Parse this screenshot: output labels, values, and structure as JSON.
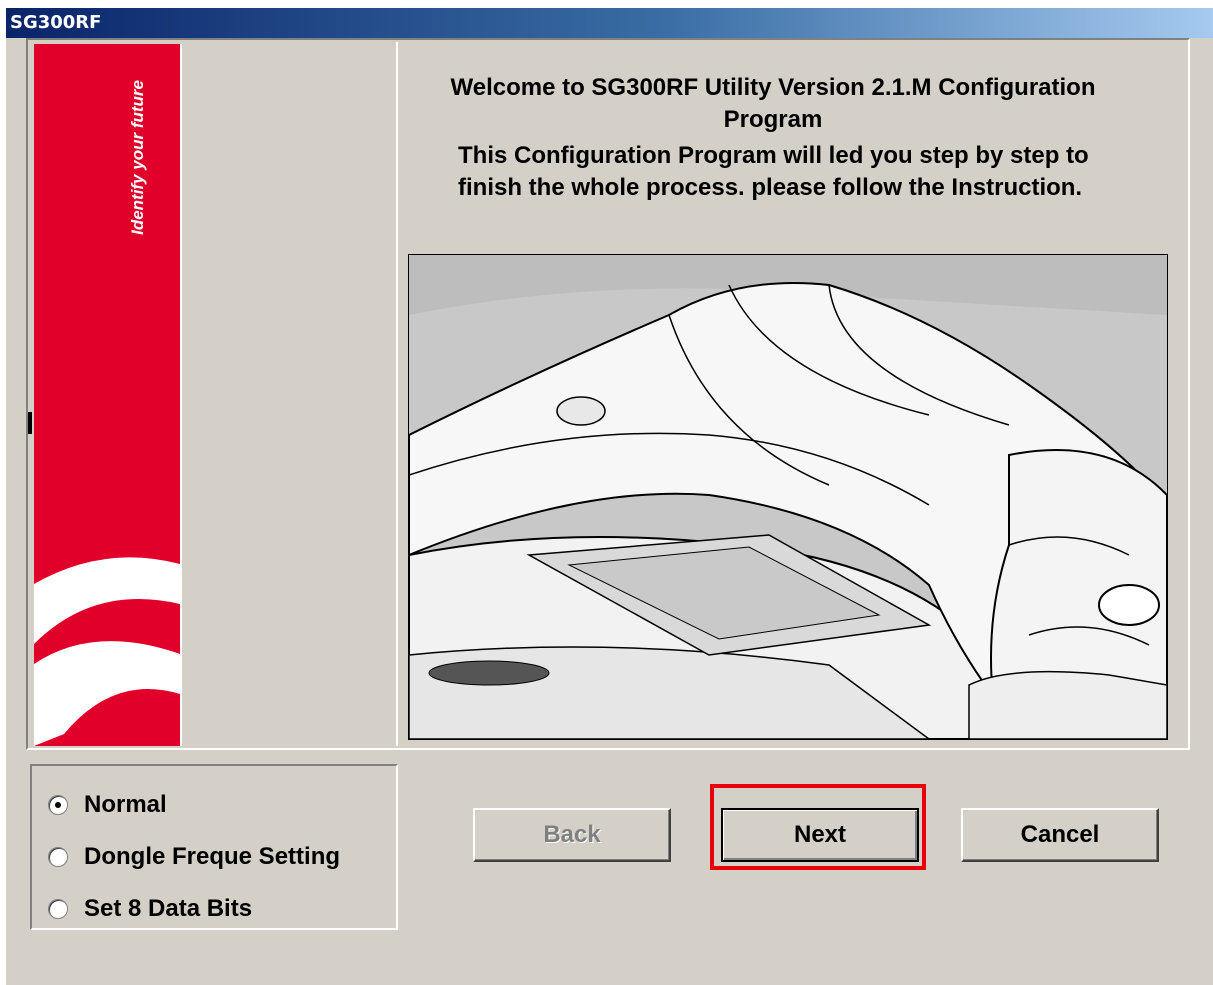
{
  "window": {
    "title": "SG300RF"
  },
  "banner": {
    "tagline": "Identify your future",
    "color": "#e0002a"
  },
  "welcome": {
    "heading": "Welcome to SG300RF Utility Version 2.1.M  Configuration Program",
    "intro": "This Configuration Program will led you step by step to finish the whole process. please follow the Instruction."
  },
  "image": {
    "subject": "barcode scanner illustration"
  },
  "options": [
    {
      "label": "Normal",
      "selected": true
    },
    {
      "label": "Dongle Freque Setting",
      "selected": false
    },
    {
      "label": "Set 8 Data Bits",
      "selected": false
    }
  ],
  "buttons": {
    "back": "Back",
    "next": "Next",
    "cancel": "Cancel"
  },
  "highlight": {
    "color": "#e8000b",
    "target": "next-button"
  }
}
